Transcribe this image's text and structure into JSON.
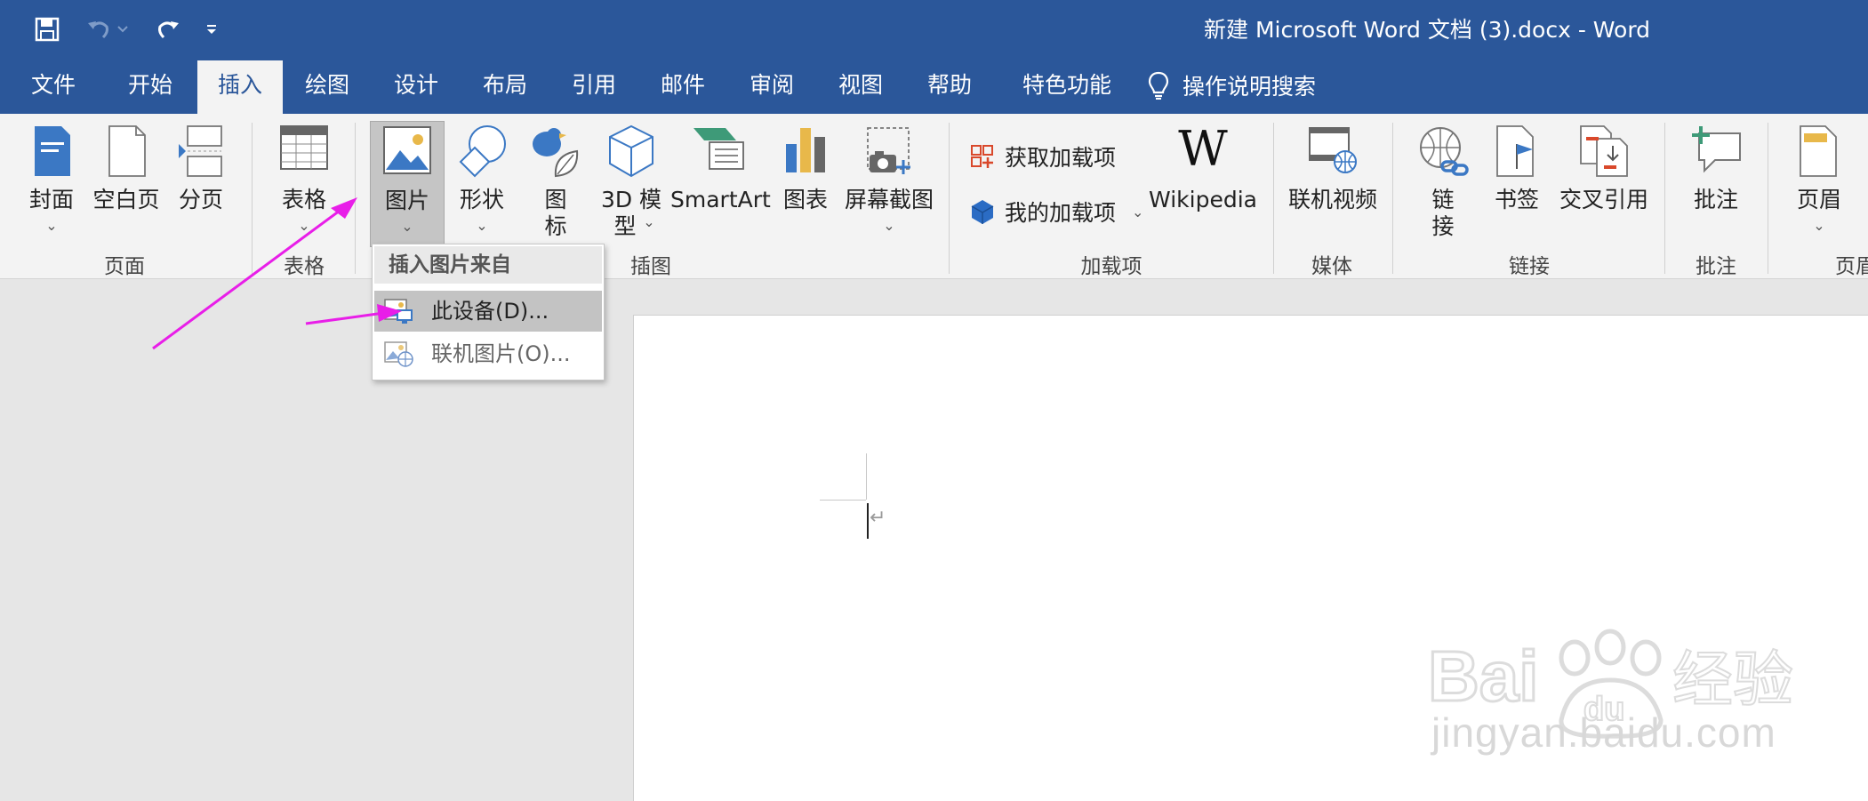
{
  "window": {
    "title": "新建 Microsoft Word 文档 (3).docx  -  Word"
  },
  "quick_access": {
    "save_icon": "save-icon",
    "undo_icon": "undo-icon",
    "redo_icon": "redo-icon",
    "customize_icon": "customize-qat-icon"
  },
  "tabs": [
    {
      "label": "文件"
    },
    {
      "label": "开始"
    },
    {
      "label": "插入"
    },
    {
      "label": "绘图"
    },
    {
      "label": "设计"
    },
    {
      "label": "布局"
    },
    {
      "label": "引用"
    },
    {
      "label": "邮件"
    },
    {
      "label": "审阅"
    },
    {
      "label": "视图"
    },
    {
      "label": "帮助"
    },
    {
      "label": "特色功能"
    }
  ],
  "active_tab": "插入",
  "tell_me": {
    "label": "操作说明搜索"
  },
  "ribbon": {
    "pages": {
      "label": "页面",
      "cover": "封面",
      "blank": "空白页",
      "break": "分页"
    },
    "tables": {
      "label": "表格",
      "table": "表格"
    },
    "illustrations": {
      "label": "插图",
      "pictures": "图片",
      "shapes": "形状",
      "icons_l1": "图",
      "icons_l2": "标",
      "model_l1": "3D 模",
      "model_l2": "型",
      "smartart": "SmartArt",
      "chart": "图表",
      "screenshot": "屏幕截图"
    },
    "addins": {
      "label": "加载项",
      "get": "获取加载项",
      "my": "我的加载项",
      "wikipedia": "Wikipedia",
      "wiki_glyph": "W"
    },
    "media": {
      "label": "媒体",
      "video": "联机视频"
    },
    "links": {
      "label": "链接",
      "link_l1": "链",
      "link_l2": "接",
      "bookmark": "书签",
      "crossref": "交叉引用"
    },
    "comments": {
      "label": "批注",
      "comment": "批注"
    },
    "header_footer": {
      "label": "页眉",
      "header": "页眉"
    }
  },
  "dropdown": {
    "header": "插入图片来自",
    "items": [
      {
        "label": "此设备(D)..."
      },
      {
        "label": "联机图片(O)..."
      }
    ]
  },
  "watermark": {
    "text": "jingyan.baidu.com",
    "logo": "Bai du 经验"
  },
  "colors": {
    "title_bar": "#2b579a",
    "ribbon": "#f3f3f3",
    "annotation_arrow": "#e81ee8"
  }
}
